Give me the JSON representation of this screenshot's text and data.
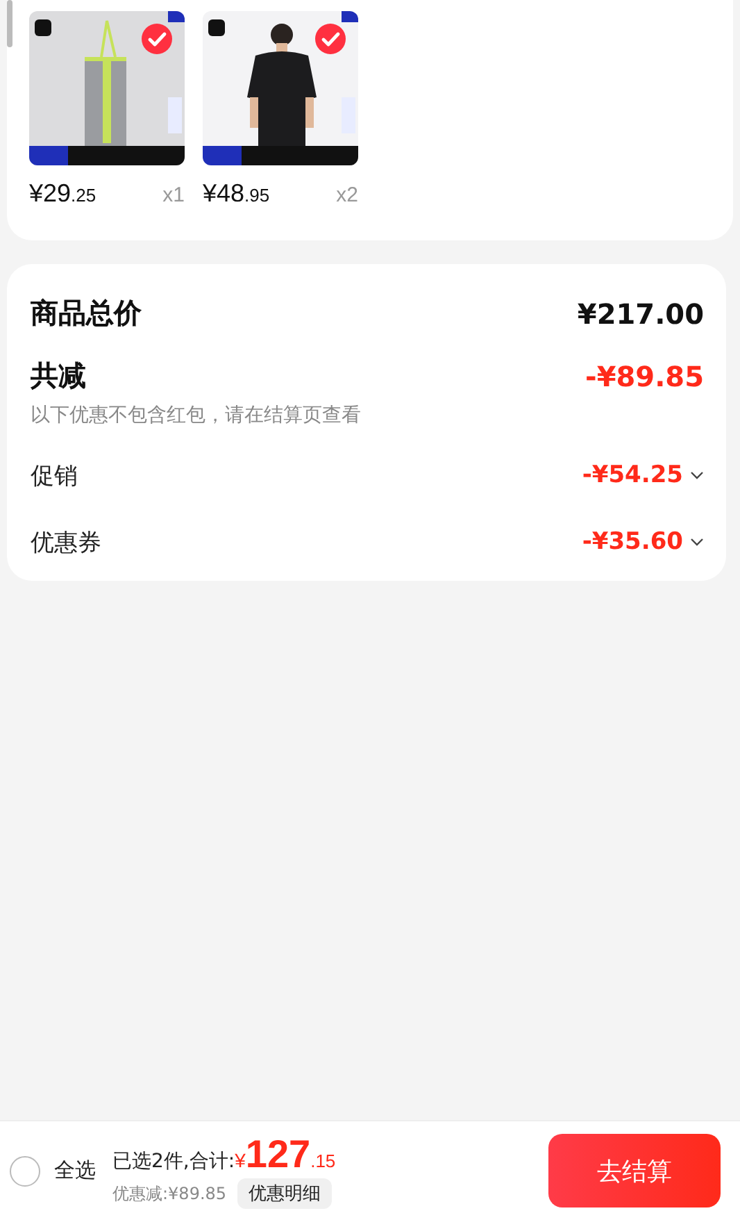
{
  "cart_items": [
    {
      "selected": true,
      "price_main": "¥29",
      "price_decimal": ".25",
      "quantity": "x1"
    },
    {
      "selected": true,
      "price_main": "¥48",
      "price_decimal": ".95",
      "quantity": "x2"
    }
  ],
  "summary": {
    "total_label": "商品总价",
    "total_value": "¥217.00",
    "discount_label": "共减",
    "discount_value": "-¥89.85",
    "note": "以下优惠不包含红包，请在结算页查看",
    "details": [
      {
        "label": "促销",
        "value": "-¥54.25",
        "expanded": false
      },
      {
        "label": "优惠券",
        "value": "-¥35.60",
        "expanded": false
      }
    ]
  },
  "footer": {
    "select_all": {
      "label": "全选",
      "checked": false
    },
    "summary_text": "已选2件,合计:",
    "currency": "¥",
    "total_main": "127",
    "total_decimal": ".15",
    "discount_text": "优惠减:¥89.85",
    "details_button": "优惠明细",
    "checkout_button": "去结算"
  }
}
